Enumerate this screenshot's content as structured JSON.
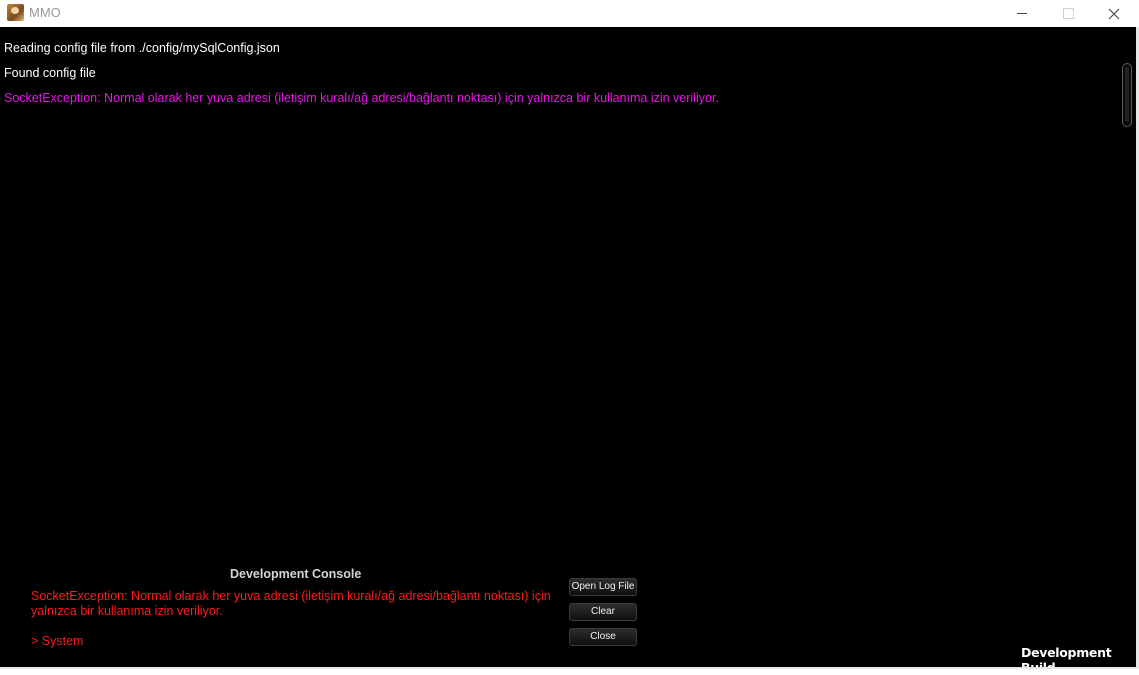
{
  "window": {
    "title": "MMO",
    "icons": {
      "app": "app-game-icon",
      "minimize": "minimize-icon",
      "maximize": "maximize-icon",
      "close": "close-icon"
    }
  },
  "log": {
    "lines": [
      {
        "text": "Reading config file from ./config/mySqlConfig.json",
        "type": "info"
      },
      {
        "text": "Found config file",
        "type": "info"
      },
      {
        "text": "SocketException: Normal olarak her yuva adresi (iletişim kuralı/ağ adresi/bağlantı noktası) için yalnızca bir kullanıma izin veriliyor.",
        "type": "error"
      }
    ],
    "error_color": "#e815e8"
  },
  "console": {
    "title": "Development Console",
    "message": "SocketException: Normal olarak her yuva adresi (iletişim kuralı/ağ adresi/bağlantı noktası) için yalnızca bir kullanıma izin veriliyor.",
    "input": "> System",
    "message_color": "#ff1a1a",
    "buttons": {
      "open_log": "Open Log File",
      "clear": "Clear",
      "close": "Close"
    }
  },
  "footer": {
    "build_label": "Development Build"
  }
}
